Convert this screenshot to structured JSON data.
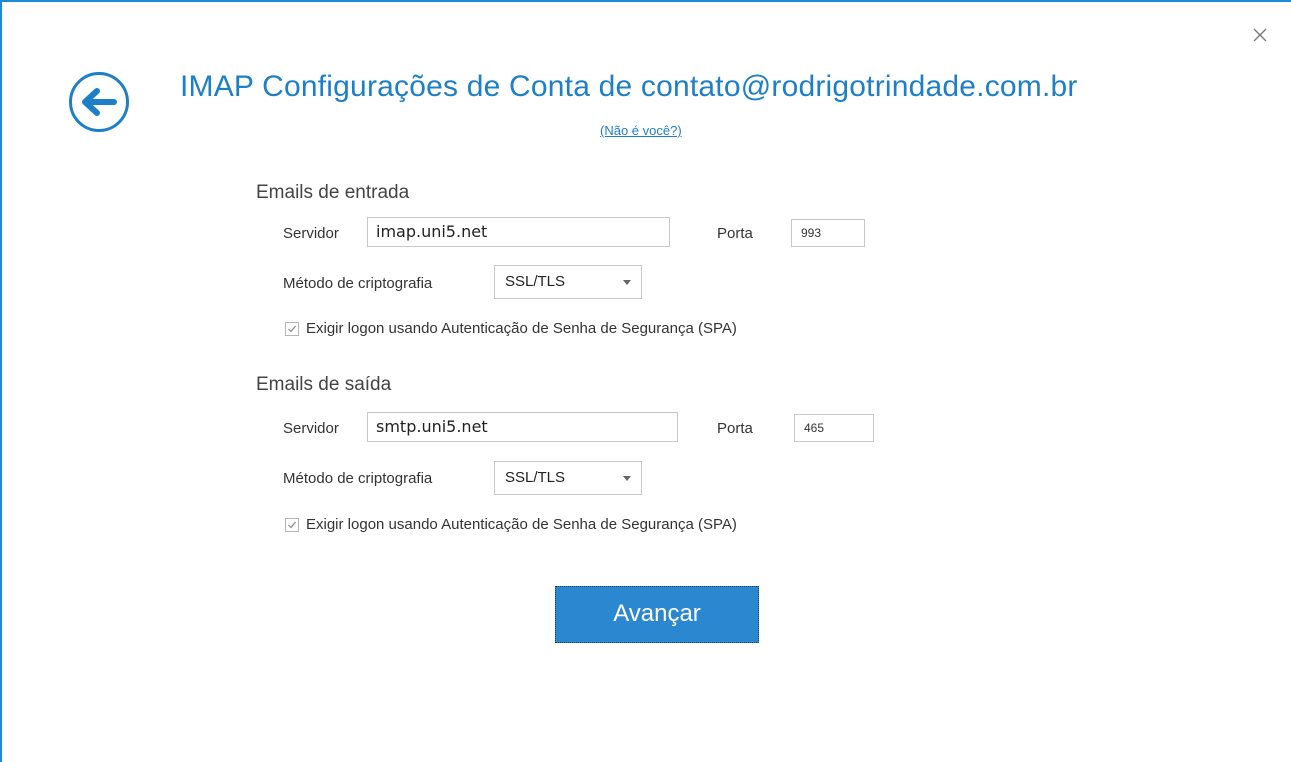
{
  "window": {
    "title": "IMAP Configurações de Conta de contato@rodrigotrindade.com.br",
    "not_you_link": "(Não é você?)",
    "accent_color": "#1e7fc9"
  },
  "incoming": {
    "section_title": "Emails de entrada",
    "server_label": "Servidor",
    "server_value": "imap.uni5.net",
    "port_label": "Porta",
    "port_value": "993",
    "encryption_label": "Método de criptografia",
    "encryption_value": "SSL/TLS",
    "spa_label": "Exigir logon usando Autenticação de Senha de Segurança (SPA)",
    "spa_checked": true
  },
  "outgoing": {
    "section_title": "Emails de saída",
    "server_label": "Servidor",
    "server_value": "smtp.uni5.net",
    "port_label": "Porta",
    "port_value": "465",
    "encryption_label": "Método de criptografia",
    "encryption_value": "SSL/TLS",
    "spa_label": "Exigir logon usando Autenticação de Senha de Segurança (SPA)",
    "spa_checked": true
  },
  "actions": {
    "next_label": "Avançar",
    "button_color": "#2a87d0"
  },
  "icons": {
    "close": "close-icon",
    "back": "back-arrow-icon",
    "dropdown": "chevron-down-icon",
    "check": "checkmark-icon"
  }
}
